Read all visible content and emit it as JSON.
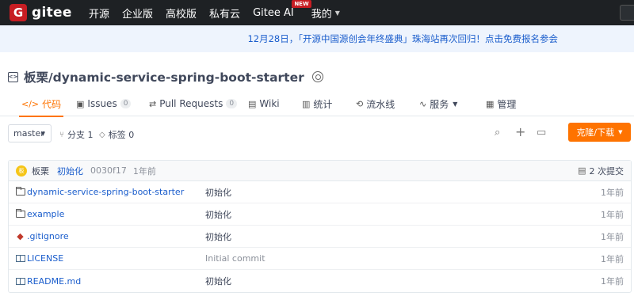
{
  "nav": {
    "logo_letter": "G",
    "logo_text": "gitee",
    "items": [
      "开源",
      "企业版",
      "高校版",
      "私有云"
    ],
    "ai_label": "Gitee AI",
    "ai_badge": "NEW",
    "mine_label": "我的"
  },
  "announcement": "12月28日，「开源中国源创会年终盛典」珠海站再次回归！点击免费报名参会",
  "repo": {
    "icon_text": "<>",
    "title": "板栗/dynamic-service-spring-boot-starter"
  },
  "tabs": [
    {
      "icon": "</>",
      "label": "代码",
      "active": true
    },
    {
      "icon": "▣",
      "label": "Issues",
      "count": "0"
    },
    {
      "icon": "⇄",
      "label": "Pull Requests",
      "count": "0"
    },
    {
      "icon": "▤",
      "label": "Wiki"
    },
    {
      "icon": "▥",
      "label": "统计"
    },
    {
      "icon": "⟲",
      "label": "流水线"
    },
    {
      "icon": "∿",
      "label": "服务",
      "dropdown": true
    },
    {
      "icon": "▦",
      "label": "管理"
    }
  ],
  "toolbar": {
    "branch": "master",
    "branches_label": "分支 1",
    "tags_label": "标签 0",
    "clone_label": "克隆/下载"
  },
  "commit": {
    "avatar_text": "板",
    "author": "板栗",
    "message": "初始化",
    "hash": "0030f17",
    "time": "1年前",
    "count_label": "2 次提交"
  },
  "files": [
    {
      "type": "folder",
      "name": "dynamic-service-spring-boot-starter",
      "message": "初始化",
      "time": "1年前"
    },
    {
      "type": "folder",
      "name": "example",
      "message": "初始化",
      "time": "1年前"
    },
    {
      "type": "git",
      "name": ".gitignore",
      "message": "初始化",
      "time": "1年前"
    },
    {
      "type": "book",
      "name": "LICENSE",
      "message": "Initial commit",
      "time": "1年前"
    },
    {
      "type": "book",
      "name": "README.md",
      "message": "初始化",
      "time": "1年前"
    }
  ]
}
